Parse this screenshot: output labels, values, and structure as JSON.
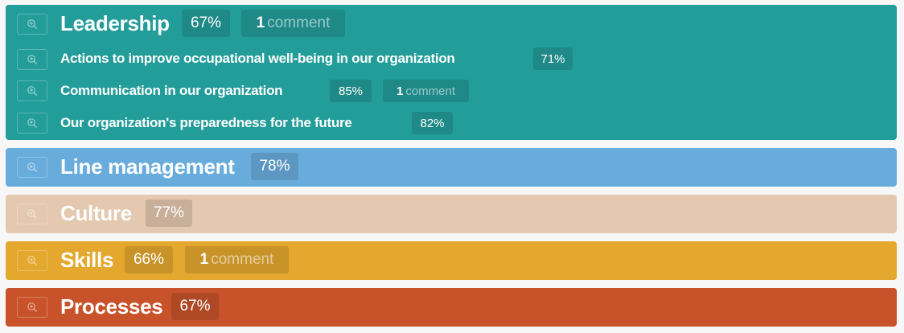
{
  "categories": [
    {
      "title": "Leadership",
      "percent": "67%",
      "comment_count": "1",
      "comment_word": "comment",
      "color": "#239d9a",
      "items": [
        {
          "title": "Actions to improve occupational well-being in our organization",
          "percent": "71%"
        },
        {
          "title": "Communication in our organization",
          "percent": "85%",
          "comment_count": "1",
          "comment_word": "comment"
        },
        {
          "title": "Our organization's preparedness for the future",
          "percent": "82%"
        }
      ]
    },
    {
      "title": "Line management",
      "percent": "78%",
      "color": "#68acdc"
    },
    {
      "title": "Culture",
      "percent": "77%",
      "color": "#e4c8b0"
    },
    {
      "title": "Skills",
      "percent": "66%",
      "comment_count": "1",
      "comment_word": "comment",
      "color": "#e4a82e"
    },
    {
      "title": "Processes",
      "percent": "67%",
      "color": "#c8532a"
    }
  ],
  "icons": {
    "zoom": "zoom-in-icon"
  }
}
